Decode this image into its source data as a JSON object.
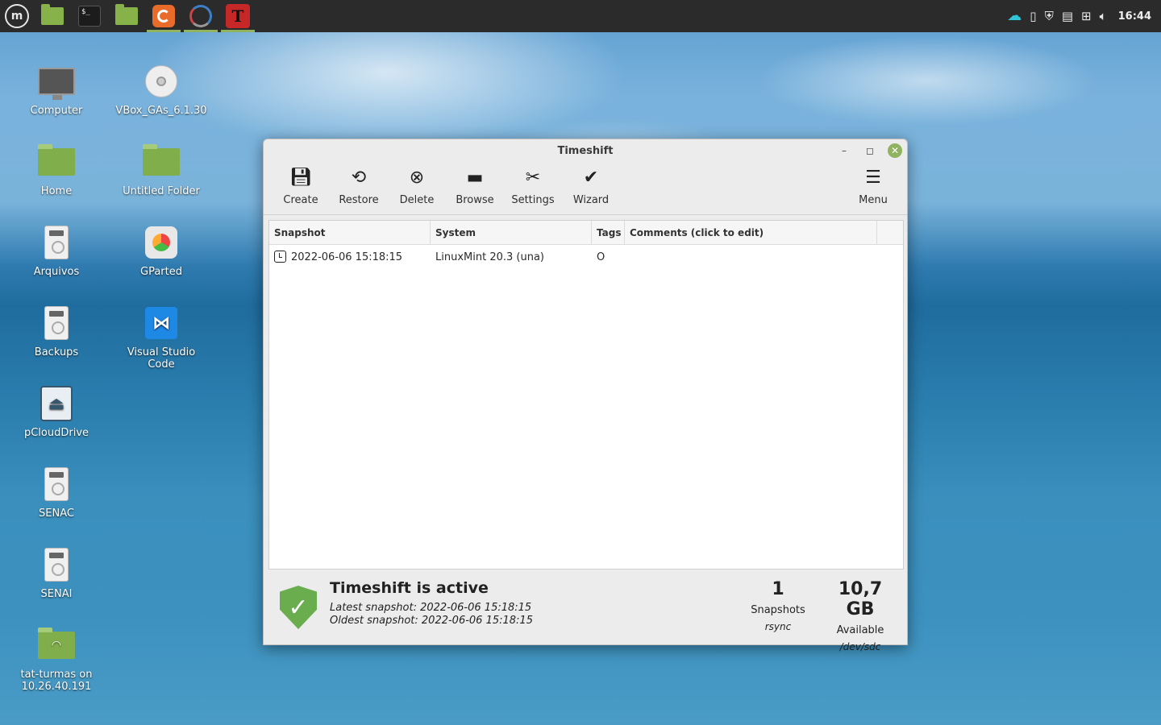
{
  "taskbar": {
    "clock": "16:44",
    "apps": [
      "menu",
      "files",
      "terminal",
      "files",
      "firefox",
      "sync",
      "timeshift"
    ]
  },
  "desktop": {
    "icons": [
      {
        "label": "Computer"
      },
      {
        "label": "VBox_GAs_6.1.30"
      },
      {
        "label": "Home"
      },
      {
        "label": "Untitled Folder"
      },
      {
        "label": "Arquivos"
      },
      {
        "label": "GParted"
      },
      {
        "label": "Backups"
      },
      {
        "label": "Visual Studio Code"
      },
      {
        "label": "pCloudDrive"
      },
      {
        "label": "SENAC"
      },
      {
        "label": "SENAI"
      },
      {
        "label": "tat-turmas on 10.26.40.191"
      }
    ]
  },
  "window": {
    "title": "Timeshift",
    "toolbar": {
      "create": "Create",
      "restore": "Restore",
      "delete": "Delete",
      "browse": "Browse",
      "settings": "Settings",
      "wizard": "Wizard",
      "menu": "Menu"
    },
    "table": {
      "columns": [
        "Snapshot",
        "System",
        "Tags",
        "Comments (click to edit)"
      ],
      "rows": [
        {
          "snapshot": "2022-06-06 15:18:15",
          "system": "LinuxMint 20.3 (una)",
          "tags": "O",
          "comments": ""
        }
      ]
    },
    "status": {
      "title": "Timeshift is active",
      "latest": "Latest snapshot: 2022-06-06 15:18:15",
      "oldest": "Oldest snapshot: 2022-06-06 15:18:15",
      "snapshots_count": "1",
      "snapshots_label": "Snapshots",
      "snapshots_sub": "rsync",
      "available": "10,7 GB",
      "available_label": "Available",
      "available_sub": "/dev/sdc"
    }
  },
  "colors": {
    "accent": "#8fb35f",
    "taskbar": "#2b2b2b",
    "shield": "#6aad4f"
  }
}
